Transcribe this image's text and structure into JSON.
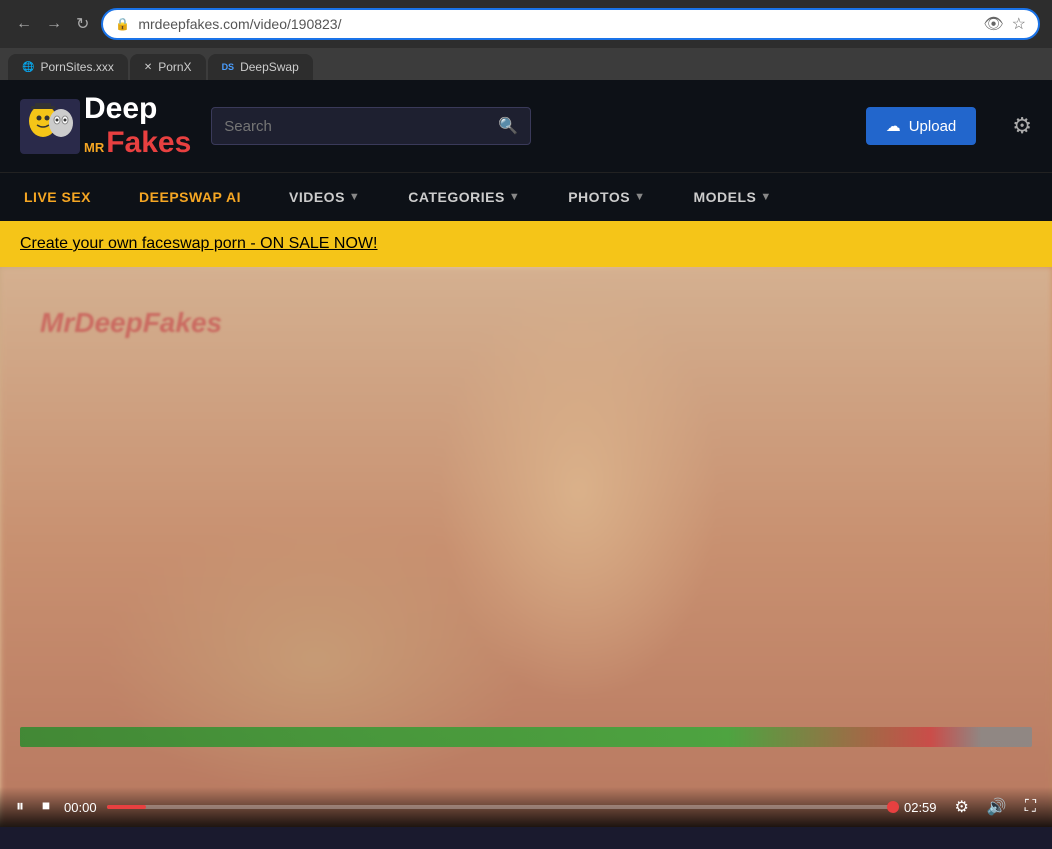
{
  "browser": {
    "address": "mrdeepfakes.com/video/190823/...",
    "address_display": "mrdeepfakes.com/video/190823/",
    "back_label": "←",
    "forward_label": "→",
    "reload_label": "↻",
    "tabs": [
      {
        "id": "tab-pornsites",
        "label": "PornSites.xxx",
        "favicon": "🌐"
      },
      {
        "id": "tab-pornx",
        "label": "PornX",
        "favicon": "✕"
      },
      {
        "id": "tab-deepswap",
        "label": "DeepSwap",
        "favicon": "DS"
      }
    ]
  },
  "header": {
    "logo_deep": "Deep",
    "logo_mr": "MR",
    "logo_fakes": "Fakes",
    "logo_icon": "🎭",
    "search_placeholder": "Search",
    "upload_label": "Upload",
    "upload_icon": "☁",
    "settings_icon": "⚙"
  },
  "nav": {
    "items": [
      {
        "id": "live-sex",
        "label": "LIVE SEX",
        "has_dropdown": false,
        "style": "live"
      },
      {
        "id": "deepswap-ai",
        "label": "DEEPSWAP AI",
        "has_dropdown": false,
        "style": "ai"
      },
      {
        "id": "videos",
        "label": "VIDEOS",
        "has_dropdown": true,
        "style": "normal"
      },
      {
        "id": "categories",
        "label": "CATEGORIES",
        "has_dropdown": true,
        "style": "normal"
      },
      {
        "id": "photos",
        "label": "PHOTOS",
        "has_dropdown": true,
        "style": "normal"
      },
      {
        "id": "models",
        "label": "MODELS",
        "has_dropdown": true,
        "style": "normal"
      }
    ]
  },
  "promo": {
    "text": "Create your own faceswap porn - ON SALE NOW!"
  },
  "video": {
    "watermark": "MrDeepFakes",
    "controls": {
      "play_icon": "▶",
      "pause_icon": "⏸",
      "stop_icon": "⏹",
      "time_current": "00:00",
      "time_total": "02:59",
      "settings_icon": "⚙",
      "volume_icon": "🔊",
      "fullscreen_icon": "⛶"
    }
  }
}
